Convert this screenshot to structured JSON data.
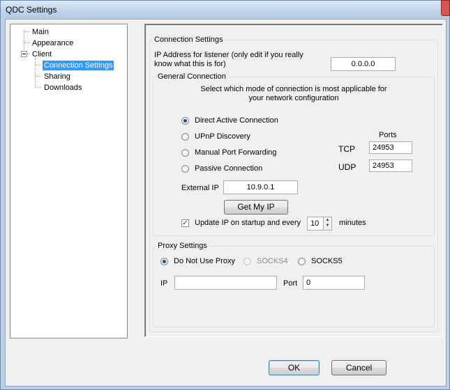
{
  "window": {
    "title": "QDC Settings"
  },
  "tree": {
    "items": [
      {
        "label": "Main"
      },
      {
        "label": "Appearance"
      },
      {
        "label": "Client"
      },
      {
        "label": "Connection Settings"
      },
      {
        "label": "Sharing"
      },
      {
        "label": "Downloads"
      }
    ],
    "selected": "Connection Settings"
  },
  "connection": {
    "group_label": "Connection Settings",
    "ip_listener_label": "IP Address for listener (only edit if you really know what this is for)",
    "ip_listener_value": "0.0.0.0"
  },
  "general": {
    "group_label": "General Connection",
    "instruction": "Select which mode of connection is most applicable for your network configuration",
    "modes": [
      {
        "label": "Direct Active Connection",
        "checked": true
      },
      {
        "label": "UPnP Discovery",
        "checked": false
      },
      {
        "label": "Manual Port Forwarding",
        "checked": false
      },
      {
        "label": "Passive Connection",
        "checked": false
      }
    ],
    "ports_label": "Ports",
    "tcp_label": "TCP",
    "tcp_value": "24953",
    "udp_label": "UDP",
    "udp_value": "24953",
    "external_ip_label": "External IP",
    "external_ip_value": "10.9.0.1",
    "get_ip_button": "Get My IP",
    "update_ip_label": "Update IP on startup and every",
    "update_ip_checked": true,
    "update_minutes": "10",
    "minutes_label": "minutes"
  },
  "proxy": {
    "group_label": "Proxy Settings",
    "options": [
      {
        "label": "Do Not Use Proxy",
        "checked": true,
        "disabled": false
      },
      {
        "label": "SOCKS4",
        "checked": false,
        "disabled": true
      },
      {
        "label": "SOCKS5",
        "checked": false,
        "disabled": false
      }
    ],
    "ip_label": "IP",
    "ip_value": "",
    "port_label": "Port",
    "port_value": "0"
  },
  "buttons": {
    "ok": "OK",
    "cancel": "Cancel"
  }
}
